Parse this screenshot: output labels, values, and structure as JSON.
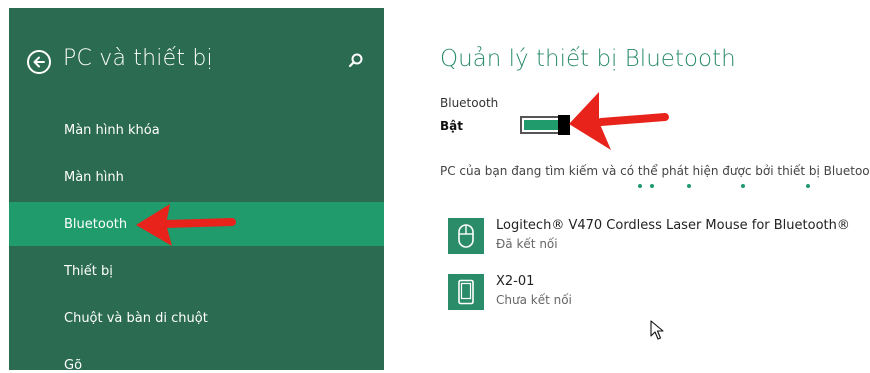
{
  "sidebar": {
    "title": "PC và thiết bị",
    "items": [
      {
        "label": "Màn hình khóa"
      },
      {
        "label": "Màn hình"
      },
      {
        "label": "Bluetooth",
        "selected": true
      },
      {
        "label": "Thiết bị"
      },
      {
        "label": "Chuột và bàn di chuột"
      },
      {
        "label": "Gõ"
      }
    ]
  },
  "main": {
    "title": "Quản lý thiết bị Bluetooth",
    "bluetooth_label": "Bluetooth",
    "bluetooth_state": "Bật",
    "toggle_on": true,
    "discover_text": "PC của bạn đang tìm kiếm và có thể phát hiện được bởi thiết bị Bluetooth",
    "devices": [
      {
        "name": "Logitech® V470 Cordless Laser Mouse for Bluetooth®",
        "status": "Đã kết nối",
        "icon": "mouse-icon"
      },
      {
        "name": "X2-01",
        "status": "Chưa kết nối",
        "icon": "phone-icon"
      }
    ]
  },
  "colors": {
    "sidebar_bg": "#2b6b52",
    "selected_bg": "#1f9b6c",
    "accent": "#2b8c69",
    "annotation_arrow": "#e8231b"
  }
}
